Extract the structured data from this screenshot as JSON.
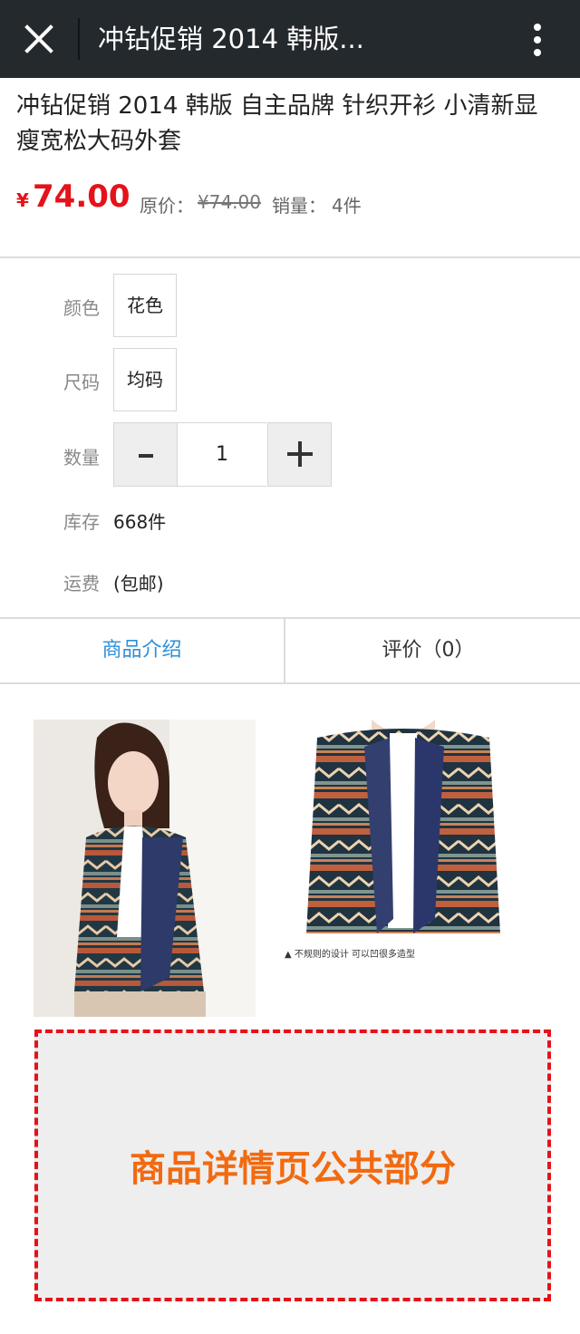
{
  "header": {
    "close_icon": "close-icon",
    "title": "冲钻促销 2014 韩版...",
    "more_icon": "more-vertical-icon"
  },
  "product": {
    "title": "冲钻促销 2014 韩版 自主品牌 针织开衫 小清新显瘦宽松大码外套",
    "currency": "¥",
    "price": "74.00",
    "original_price_label": "原价：",
    "original_price": "¥74.00",
    "sales_label": "销量：",
    "sales": "4件"
  },
  "options": {
    "color_label": "颜色",
    "color_value": "花色",
    "size_label": "尺码",
    "size_value": "均码",
    "quantity_label": "数量",
    "quantity_value": "1",
    "stock_label": "库存",
    "stock_value": "668件",
    "shipping_label": "运费",
    "shipping_value": "(包邮)"
  },
  "tabs": [
    {
      "label": "商品介绍",
      "active": true
    },
    {
      "label": "评价（0）",
      "active": false
    }
  ],
  "detail": {
    "caption": "▲ 不规则的设计 可以凹很多造型",
    "common_section": "商品详情页公共部分"
  },
  "colors": {
    "topbar": "#24292d",
    "price_red": "#e4121a",
    "tab_active": "#2f8fd6",
    "common_text": "#f26a10"
  }
}
